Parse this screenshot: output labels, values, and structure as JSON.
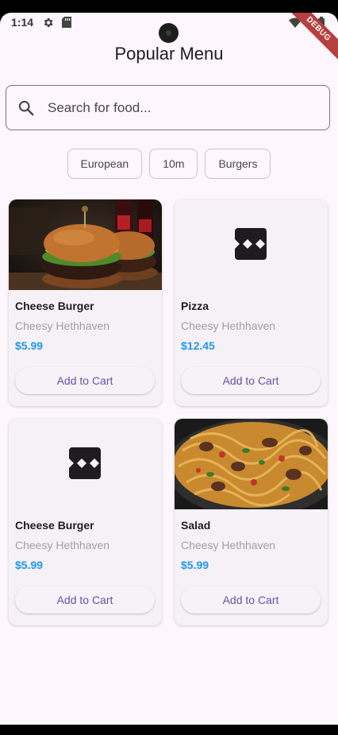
{
  "status_bar": {
    "time": "1:14",
    "icons": [
      "gear-icon",
      "sd-card-icon",
      "wifi-icon",
      "battery-icon"
    ],
    "debug_label": "DEBUG"
  },
  "header": {
    "title": "Popular Menu"
  },
  "search": {
    "placeholder": "Search for food...",
    "value": ""
  },
  "chips": [
    {
      "label": "European"
    },
    {
      "label": "10m"
    },
    {
      "label": "Burgers"
    }
  ],
  "products": [
    {
      "name": "Cheese Burger",
      "restaurant": "Cheesy Hethhaven",
      "price": "$5.99",
      "button": "Add to Cart",
      "image": "burger-photo"
    },
    {
      "name": "Pizza",
      "restaurant": "Cheesy Hethhaven",
      "price": "$12.45",
      "button": "Add to Cart",
      "image": "broken-image-icon"
    },
    {
      "name": "Cheese Burger",
      "restaurant": "Cheesy Hethhaven",
      "price": "$5.99",
      "button": "Add to Cart",
      "image": "broken-image-icon"
    },
    {
      "name": "Salad",
      "restaurant": "Cheesy Hethhaven",
      "price": "$5.99",
      "button": "Add to Cart",
      "image": "pasta-photo"
    }
  ],
  "colors": {
    "background": "#fdf6fd",
    "price": "#2196f3",
    "button_text": "#6750a4",
    "card": "#f6f1f6"
  }
}
